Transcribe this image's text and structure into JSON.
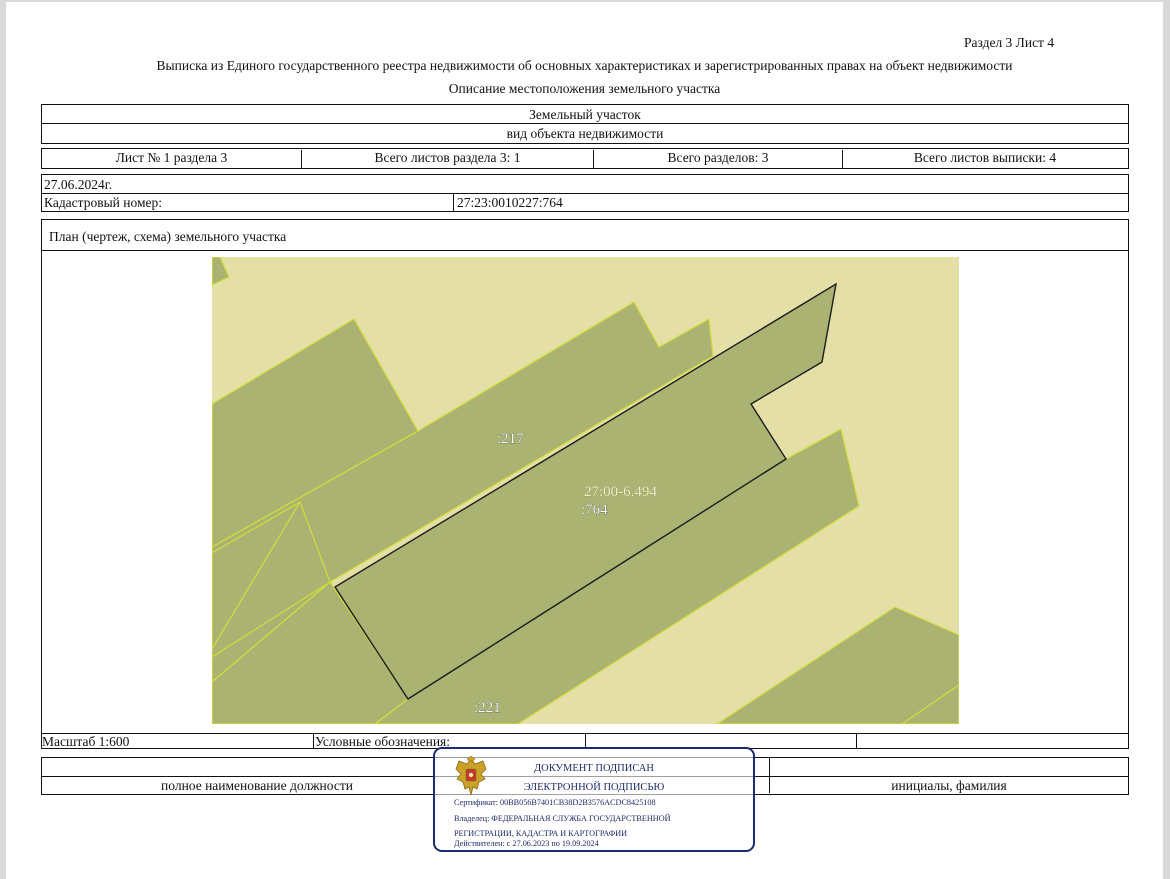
{
  "header": {
    "section_sheet": "Раздел 3    Лист 4",
    "title": "Выписка из Единого государственного реестра недвижимости об основных характеристиках и зарегистрированных правах на объект недвижимости",
    "subtitle": "Описание местоположения земельного участка"
  },
  "object": {
    "type": "Земельный участок",
    "type_caption": "вид объекта недвижимости"
  },
  "sheets": {
    "sheet_of_section": "Лист № 1 раздела 3",
    "total_section_sheets": "Всего листов раздела 3: 1",
    "total_sections": "Всего разделов: 3",
    "total_extract_sheets": "Всего листов выписки: 4"
  },
  "info": {
    "date": "27.06.2024г.",
    "cadastral_label": "Кадастровый номер:",
    "cadastral_value": "27:23:0010227:764"
  },
  "plan": {
    "title": "План (чертеж, схема) земельного участка"
  },
  "map": {
    "labels": {
      "parcel_217": ":217",
      "quarter": "27:00-6.494",
      "parcel_764": ":764",
      "parcel_221": ":221"
    },
    "colors": {
      "background": "#e3dfa6",
      "parcel_fill": "#aab372",
      "parcel_border": "#d4dc3c",
      "subject_border": "#1d1d1d"
    }
  },
  "footer": {
    "scale": "Масштаб 1:600",
    "legend": "Условные обозначения:",
    "position_caption": "полное наименование должности",
    "initials_caption": "инициалы, фамилия"
  },
  "stamp": {
    "line1": "ДОКУМЕНТ ПОДПИСАН",
    "line2": "ЭЛЕКТРОННОЙ ПОДПИСЬЮ",
    "certificate": "Сертификат: 00BB056B7401CB38D2B3576ACDC8425108",
    "owner_line1": "Владелец: ФЕДЕРАЛЬНАЯ СЛУЖБА ГОСУДАРСТВЕННОЙ",
    "owner_line2": "РЕГИСТРАЦИИ, КАДАСТРА И КАРТОГРАФИИ",
    "valid": "Действителен: с 27.06.2023 по 19.09.2024",
    "emblem": "russian-eagle-emblem",
    "color": "#1c2a6e"
  }
}
